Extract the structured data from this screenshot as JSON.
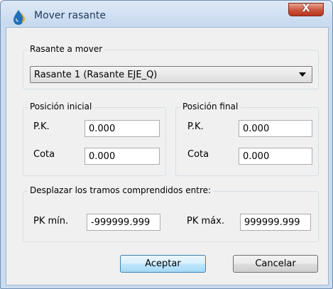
{
  "window": {
    "title": "Mover rasante",
    "close_label": "X"
  },
  "rasante_group": {
    "legend": "Rasante a mover",
    "selected": "Rasante 1 (Rasante EJE_Q)"
  },
  "posicion_inicial": {
    "legend": "Posición inicial",
    "pk_label": "P.K.",
    "pk_value": "0.000",
    "cota_label": "Cota",
    "cota_value": "0.000"
  },
  "posicion_final": {
    "legend": "Posición final",
    "pk_label": "P.K.",
    "pk_value": "0.000",
    "cota_label": "Cota",
    "cota_value": "0.000"
  },
  "desplazar": {
    "legend": "Desplazar los tramos comprendidos entre:",
    "pk_min_label": "PK mín.",
    "pk_min_value": "-999999.999",
    "pk_max_label": "PK máx.",
    "pk_max_value": "999999.999"
  },
  "buttons": {
    "accept": "Aceptar",
    "cancel": "Cancelar"
  },
  "colors": {
    "frame": "#c9dbef",
    "client": "#f0f0f0",
    "close": "#c9543d",
    "default_button": "#bee6fd"
  },
  "icons": {
    "app": "app-drop-icon",
    "close": "close-icon",
    "dropdown": "chevron-down-icon"
  }
}
